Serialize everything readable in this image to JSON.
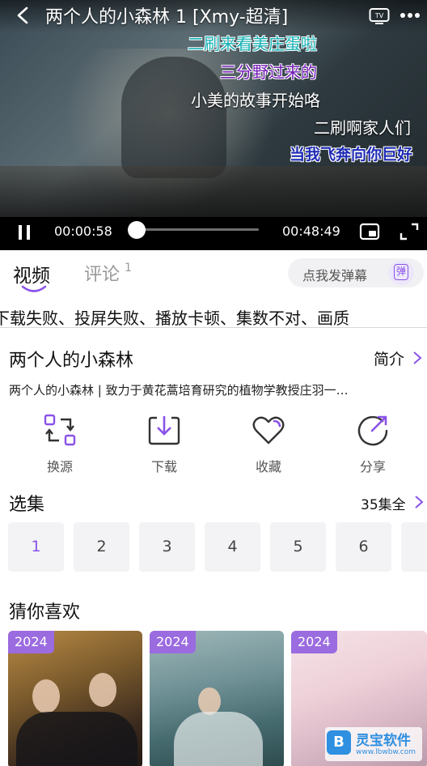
{
  "player": {
    "title": "两个人的小森林 1 [Xmy-超清]",
    "danmaku": [
      "二刷来看美庄蛋啦",
      "三分野过来的",
      "小美的故事开始咯",
      "二刷啊家人们",
      "当我飞奔向你巨好"
    ],
    "current_time": "00:00:58",
    "total_time": "00:48:49",
    "progress_fraction": 0.02
  },
  "tabs": {
    "video": "视频",
    "comment": "评论",
    "comment_count": "1",
    "danmaku_placeholder": "点我发弹幕",
    "danmaku_send_icon_text": "弹"
  },
  "notice": "下载失败、投屏失败、播放卡顿、集数不对、画质",
  "info": {
    "title": "两个人的小森林",
    "intro_label": "简介",
    "description": "两个人的小森林 | 致力于黄花蒿培育研究的植物学教授庄羽一…"
  },
  "actions": [
    {
      "label": "换源",
      "icon": "switch-source-icon"
    },
    {
      "label": "下载",
      "icon": "download-icon"
    },
    {
      "label": "收藏",
      "icon": "heart-icon"
    },
    {
      "label": "分享",
      "icon": "share-icon"
    }
  ],
  "episodes": {
    "title": "选集",
    "total": "35集全",
    "items": [
      "1",
      "2",
      "3",
      "4",
      "5",
      "6"
    ],
    "active": "1"
  },
  "recommend": {
    "title": "猜你喜欢",
    "cards": [
      {
        "year": "2024"
      },
      {
        "year": "2024"
      },
      {
        "year": "2024"
      }
    ]
  },
  "watermark": {
    "name": "灵宝软件",
    "url": "www.lbwbw.com"
  },
  "colors": {
    "accent": "#8a52e8",
    "danmaku_teal": "#16b1b4",
    "danmaku_purple": "#7219b5",
    "danmaku_blue": "#1e2bb5"
  }
}
